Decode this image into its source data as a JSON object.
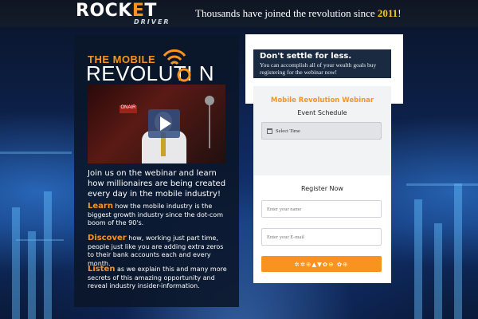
{
  "header": {
    "logo_main_1": "ROCK",
    "logo_main_hl": "E",
    "logo_main_2": "T",
    "logo_sub": "DRIVER",
    "tagline_pre": "Thousands have joined the revolution since ",
    "tagline_year": "2011",
    "tagline_post": "!"
  },
  "brand": {
    "title_line1": "THE MOBILE",
    "title_line2": "REVOLUTI  N",
    "wifi_icon": "wifi-icon"
  },
  "video": {
    "sign_text": "ONAIR",
    "play_icon": "play-icon"
  },
  "content": {
    "intro": "Join us on the webinar and learn how millionaires are being created every day in the mobile industry!",
    "learn_kw": "Learn",
    "learn_text": " how the mobile industry is the biggest growth industry since the dot-com boom of the 90's.",
    "discover_kw": "Discover",
    "discover_text": " how, working just part time, people just like you are adding extra zeros to their bank accounts each and every month.",
    "listen_kw": "Listen",
    "listen_text": " as we explain this and many more secrets of this amazing opportunity and reveal industry insider-information."
  },
  "form": {
    "headline": "Don't settle for less.",
    "subheadline": "You can accomplish all of your wealth goals buy registering for the webinar now!",
    "webinar_title": "Mobile Revolution Webinar",
    "event_schedule_label": "Event Schedule",
    "select_time_label": "Select Time",
    "calendar_icon": "calendar-icon",
    "register_label": "Register Now",
    "name_placeholder": "Enter your name",
    "email_placeholder": "Enter your E-mail",
    "submit_label": "✲✲⊕▲▼✿⊕ ✿⊕"
  },
  "colors": {
    "accent": "#f7931e",
    "year": "#f7c11e",
    "panel": "#0a1628",
    "form_head": "#1a2a40"
  }
}
